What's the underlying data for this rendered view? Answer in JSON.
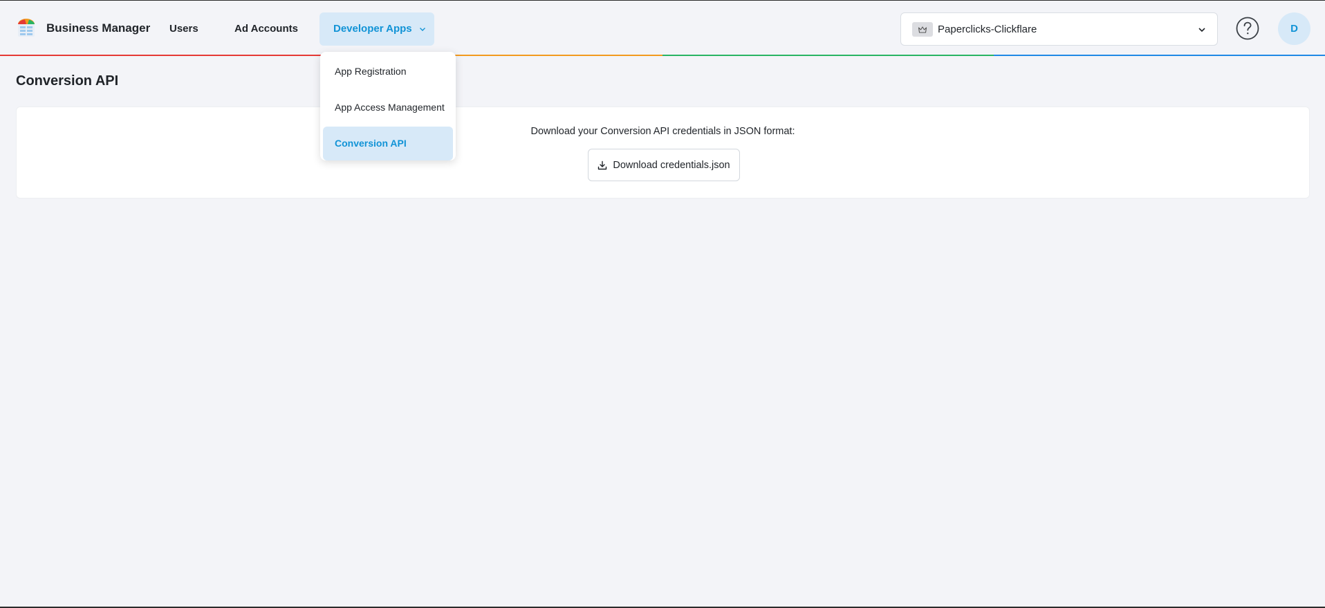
{
  "header": {
    "brand": "Business Manager",
    "nav": {
      "users": "Users",
      "ad_accounts": "Ad Accounts",
      "developer_apps": "Developer Apps"
    },
    "business_selector": {
      "selected": "Paperclicks-Clickflare"
    },
    "avatar_initial": "D"
  },
  "dropdown": {
    "items": [
      {
        "label": "App Registration",
        "active": false
      },
      {
        "label": "App Access Management",
        "active": false
      },
      {
        "label": "Conversion API",
        "active": true
      }
    ]
  },
  "main": {
    "title": "Conversion API",
    "card": {
      "description": "Download your Conversion API credentials in JSON format:",
      "download_label": "Download credentials.json"
    }
  },
  "colors": {
    "accent": "#1193d6",
    "accent_bg": "#d7e9f8",
    "page_bg": "#f3f4f8"
  },
  "icons": {
    "logo": "app-logo-icon",
    "chevron": "chevron-down-icon",
    "business": "crown-icon",
    "help": "help-circle-icon",
    "download": "download-icon"
  }
}
